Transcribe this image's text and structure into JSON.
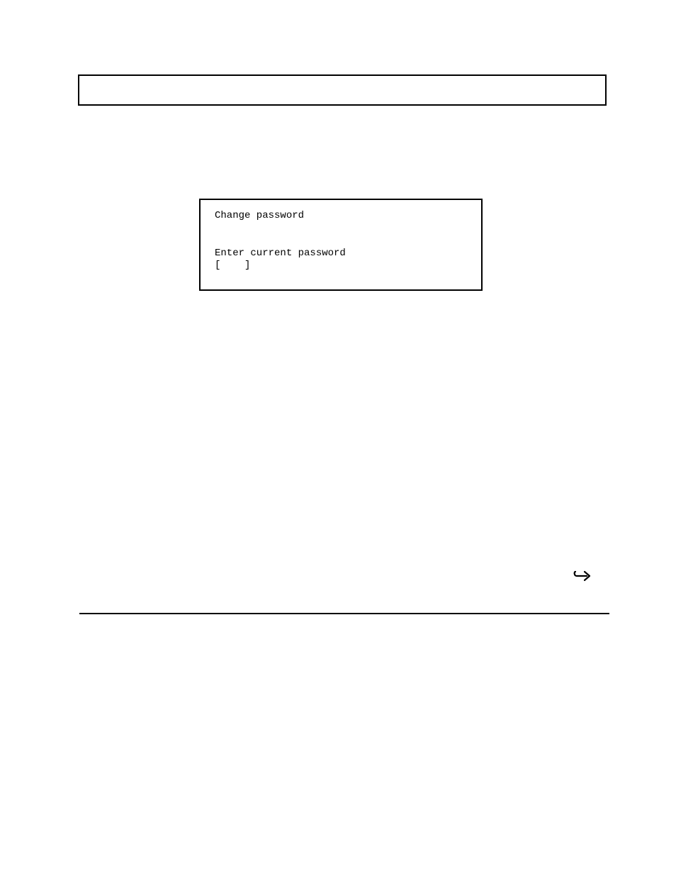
{
  "terminal": {
    "title": "Change password",
    "prompt": "Enter current password",
    "input_open": "[",
    "input_close": "]",
    "input_value": "    "
  },
  "icons": {
    "continue_arrow": "continue-arrow"
  }
}
